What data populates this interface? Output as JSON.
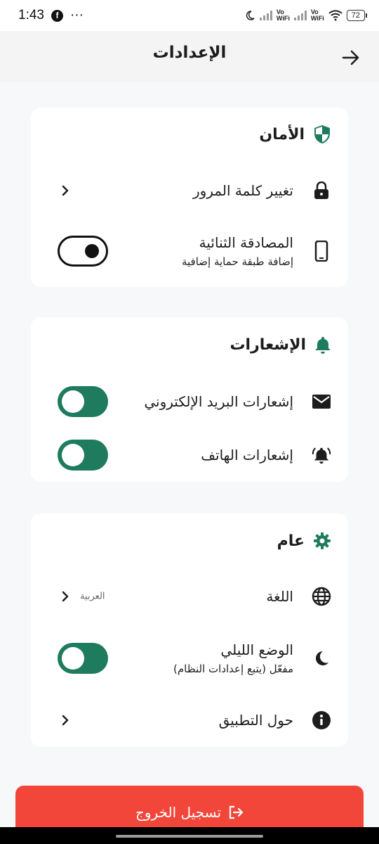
{
  "status_bar": {
    "time": "1:43",
    "dots": "···",
    "carrier1": "Vo\nWiFi",
    "carrier2": "Vo\nWiFi",
    "battery": "72"
  },
  "header": {
    "title": "الإعدادات"
  },
  "security": {
    "title": "الأمان",
    "change_password": "تغيير كلمة المرور",
    "two_factor": "المصادقة الثنائية",
    "two_factor_sub": "إضافة طبقة حماية إضافية",
    "two_factor_enabled": false
  },
  "notifications": {
    "title": "الإشعارات",
    "email": "إشعارات البريد الإلكتروني",
    "email_enabled": true,
    "phone": "إشعارات الهاتف",
    "phone_enabled": true
  },
  "general": {
    "title": "عام",
    "language": "اللغة",
    "language_value": "العربية",
    "dark_mode": "الوضع الليلي",
    "dark_mode_sub": "مفعّل (يتبع إعدادات النظام)",
    "dark_mode_enabled": true,
    "about": "حول التطبيق"
  },
  "logout": {
    "label": "تسجيل الخروج"
  },
  "colors": {
    "accent": "#1e7b5e",
    "danger": "#f2463a"
  }
}
